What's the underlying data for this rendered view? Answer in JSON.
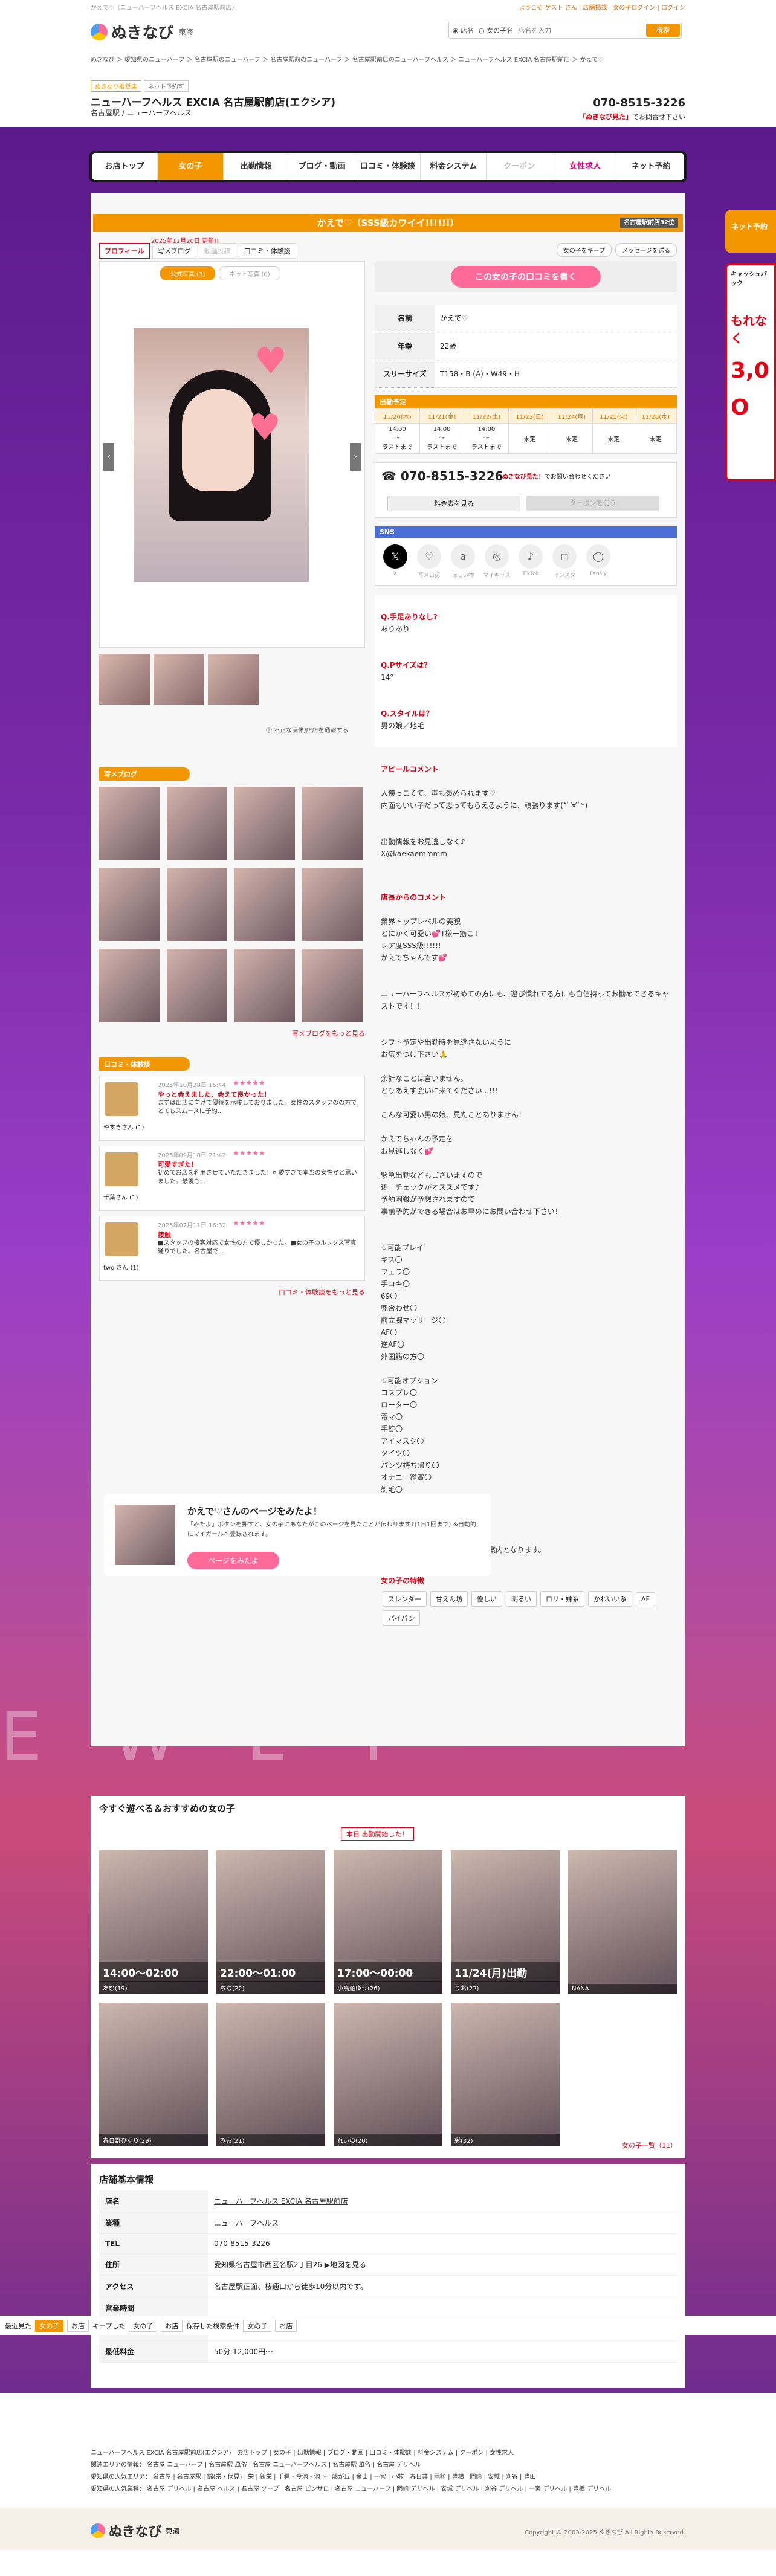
{
  "header": {
    "top_text": "かえで♡（ニューハーフヘルス EXCIA 名古屋駅前店）",
    "top_links": "ようこそ ゲスト さん | 店舗掲載 | 女の子ログイン | ログイン",
    "logo": "ぬきなび",
    "region": "東海",
    "search_opt1": "◉ 店名",
    "search_opt2": "○ 女の子名",
    "search_placeholder": "店名を入力",
    "search_button": "検索"
  },
  "breadcrumb": "ぬきなび ＞ 愛知県のニューハーフ ＞ 名古屋駅のニューハーフ ＞ 名古屋駅前のニューハーフ ＞ 名古屋駅前店のニューハーフヘルス ＞ ニューハーフヘルス EXCIA 名古屋駅前店 ＞ かえで♡",
  "shop": {
    "tag1": "ぬきなび推奨店",
    "tag2": "ネット予約可",
    "name": "ニューハーフヘルス EXCIA 名古屋駅前店(エクシア)",
    "sub": "名古屋駅 / ニューハーフヘルス",
    "tel": "070-8515-3226",
    "tel_note_b": "「ぬきなび見た」",
    "tel_note": "でお問合せ下さい"
  },
  "nav": [
    "お店トップ",
    "女の子",
    "出勤情報",
    "ブログ・動画",
    "口コミ・体験談",
    "料金システム",
    "クーポン",
    "女性求人",
    "ネット予約"
  ],
  "girl": {
    "title": "かえで♡（SSS級カワイイ!!!!!!）",
    "ranking": "名古屋駅前店32位",
    "updated": "2025年11月20日 更新!!",
    "tabs": [
      "プロフィール",
      "写メブログ",
      "動画投稿",
      "口コミ・体験談"
    ],
    "btn_fav": "女の子をキープ",
    "btn_msg": "メッセージを送る",
    "photo_tab_on": "公式写真 (3)",
    "photo_tab_off": "ネット写真 (0)",
    "report": "不正な画像/店店を通報する",
    "kuchikomi": "この女の子の口コミを書く",
    "profile": [
      {
        "k": "名前",
        "v": "かえで♡"
      },
      {
        "k": "年齢",
        "v": "22歳"
      },
      {
        "k": "スリーサイズ",
        "v": "T158・B (A)・W49・H"
      }
    ],
    "schedule_title": "出勤予定",
    "schedule_days": [
      "11/20(木)",
      "11/21(金)",
      "11/22(土)",
      "11/23(日)",
      "11/24(月)",
      "11/25(火)",
      "11/26(水)"
    ],
    "schedule_times": [
      "14:00\n〜\nラストまで",
      "14:00\n〜\nラストまで",
      "14:00\n〜\nラストまで",
      "未定",
      "未定",
      "未定",
      "未定"
    ],
    "tel": "070-8515-3226",
    "tel_note_b": "ぬきなび見た！",
    "tel_note": "でお問い合わせください",
    "btn_price": "料金表を見る",
    "btn_coupon": "クーポンを使う",
    "sns_title": "SNS",
    "sns": [
      "X",
      "写メ日記",
      "ほしい物",
      "マイキャス",
      "TikTok",
      "インスタ",
      "Fansly"
    ],
    "qa": [
      {
        "q": "Q.手足ありなし?",
        "a": "ありあり"
      },
      {
        "q": "Q.Pサイズは？",
        "a": "14°"
      },
      {
        "q": "Q.スタイルは？",
        "a": "男の娘／地毛"
      }
    ],
    "appeal_title": "アピールコメント",
    "appeal": "人懐っこくて、声も褒められます♡\n内面もいい子だって思ってもらえるように、頑張ります(*ﾟ∀ﾟ*)\n\n\n出勤情報をお見逃しなく♪\nX@kaekaemmmm",
    "staff_title": "店長からのコメント",
    "staff": "業界トップレベルの美貌\nとにかく可愛い💕T様一筋こT\nレア度SSS級!!!!!!\nかえでちゃんです💕\n\n\nニューハーフヘルスが初めての方にも、遊び慣れてる方にも自信持ってお勧めできるキャストです！！\n\n\nシフト予定や出勤時を見逃さないように\nお気をつけ下さい🙏\n\n余計なことは言いません。\nとりあえず会いに来てください...!!!\n\nこんな可愛い男の娘、見たことありません！\n\nかえでちゃんの予定を\nお見逃しなく💕\n\n緊急出勤などもございますので\n逐一チェックがオススメです♪\n予約困難が予想されますので\n事前予約ができる場合はお早めにお問い合わせ下さい！\n\n\n☆可能プレイ\nキス〇\nフェラ〇\n手コキ〇\n69〇\n兜合わせ〇\n前立腺マッサージ〇\nAF〇\n逆AF〇\n外国籍の方〇\n\n☆可能オプション\nコスプレ〇\nローター〇\n電マ〇\n手錠〇\nアイマスク〇\nタイツ〇\nパンツ持ち帰り〇\nオナニー鑑賞〇\n剃毛〇\n聖水〇\n写真撮影5枚〇\n動画撮影〇\n\n☆スタンダードコースのみでのご案内となります。",
    "features_title": "女の子の特徴",
    "features": [
      "スレンダー",
      "甘えん坊",
      "優しい",
      "明るい",
      "ロリ・妹系",
      "かわいい系",
      "AF",
      "パイパン"
    ],
    "blog_title": "写メブログ",
    "blog_more": "写メブログをもっと見る",
    "reviews_title": "口コミ・体験談",
    "reviews": [
      {
        "name": "やすきさん (1)",
        "date": "2025年10月28日 16:44",
        "title": "やっと会えました、会えて良かった！",
        "body": "まずは出店に向けて優待を示唆しておりました。女性のスタッフのの方でとてもスムースに予約..."
      },
      {
        "name": "千葉さん (1)",
        "date": "2025年09月18日 21:42",
        "title": "可愛すぎた！",
        "body": "初めてお店を利用させていただきました！可愛すぎて本当の女性かと思いました。最後も..."
      },
      {
        "name": "two さん (1)",
        "date": "2025年07月11日 16:32",
        "title": "接触",
        "body": "■スタッフの接客対応で女性の方で優しかった。■女の子のルックス写真通りでした。名古屋で..."
      }
    ],
    "reviews_more": "口コミ・体験談をもっと見る"
  },
  "cta": {
    "title": "かえで♡さんのページをみたよ！",
    "desc": "「みたよ」ボタンを押すと、女の子にあなたがこのページを見たことが伝わります♪(1日1回まで) ※自動的にマイガールへ登録されます。",
    "button": "ページをみたよ"
  },
  "recommend": {
    "title": "今すぐ遊べる＆おすすめの女の子",
    "badge": "本日 出勤開始した！",
    "cards": [
      {
        "time": "14:00〜02:00",
        "name": "あむ(19)"
      },
      {
        "time": "22:00〜01:00",
        "name": "ちな(22)"
      },
      {
        "time": "17:00〜00:00",
        "name": "小鳥遊ゆう(26)"
      },
      {
        "time": "11/24(月)出勤",
        "name": "りお(22)"
      },
      {
        "time": "",
        "name": "NANA"
      },
      {
        "time": "",
        "name": "春日野ひなり(29)"
      },
      {
        "time": "",
        "name": "みお(21)"
      },
      {
        "time": "",
        "name": "れいの(20)"
      },
      {
        "time": "",
        "name": "彩(32)"
      }
    ],
    "more": "女の子一覧（11）"
  },
  "shopinfo": {
    "title": "店舗基本情報",
    "rows": [
      {
        "k": "店名",
        "v": "ニューハーフヘルス EXCIA 名古屋駅前店"
      },
      {
        "k": "業種",
        "v": "ニューハーフヘルス"
      },
      {
        "k": "TEL",
        "v": "070-8515-3226"
      },
      {
        "k": "住所",
        "v": "愛知県名古屋市西区名駅2丁目26 ▶地図を見る"
      },
      {
        "k": "アクセス",
        "v": "名古屋駅正面、桜通口から徒歩10分以内です。"
      },
      {
        "k": "営業時間",
        "v": ""
      },
      {
        "k": "定休日",
        "v": ""
      },
      {
        "k": "最低料金",
        "v": "50分 12,000円〜"
      }
    ]
  },
  "bottombar": [
    "最近見た",
    "女の子",
    "お店",
    "キープした",
    "女の子",
    "お店",
    "保存した検索条件",
    "女の子",
    "お店"
  ],
  "footer": {
    "line1": "ニューハーフヘルス EXCIA 名古屋駅前店(エクシア) | お店トップ | 女の子 | 出勤情報 | ブログ・動画 | 口コミ・体験談 | 料金システム | クーポン | 女性求人",
    "line2": "関連エリアの情報： 名古屋 ニューハーフ | 名古屋駅 風俗 | 名古屋 ニューハーフヘルス | 名古屋駅 風俗 | 名古屋 デリヘル",
    "line3": "愛知県の人気エリア： 名古屋 | 名古屋駅 | 錦(栄・伏見) | 栄 | 新栄 | 千種・今池・池下 | 藤が丘 | 金山 | 一宮 | 小牧 | 春日井 | 岡崎 | 豊橋 | 岡崎 | 安城 | 刈谷 | 豊田",
    "line4": "愛知県の人気業種： 名古屋 デリヘル | 名古屋 ヘルス | 名古屋 ソープ | 名古屋 ピンサロ | 名古屋 ニューハーフ | 岡崎 デリヘル | 安城 デリヘル | 刈谷 デリヘル | 一宮 デリヘル | 豊橋 デリヘル",
    "logo": "ぬきなび",
    "region": "東海",
    "copy": "Copyright © 2003-2025 ぬきなび All Rights Reserved."
  },
  "side": {
    "tab": "ネット予約",
    "ad1": "キャッシュバック",
    "ad2": "もれなく",
    "ad3": "3,0",
    "ad4": "O"
  },
  "bgtext": "E W   L T"
}
